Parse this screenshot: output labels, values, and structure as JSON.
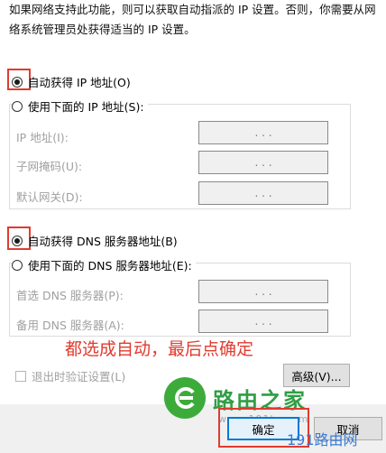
{
  "description_text": "如果网络支持此功能，则可以获取自动指派的 IP 设置。否则，你需要从网络系统管理员处获得适当的 IP 设置。",
  "ip_section": {
    "auto_label": "自动获得 IP 地址(O)",
    "auto_selected": true,
    "manual_label": "使用下面的 IP 地址(S):",
    "fields": [
      {
        "label": "IP 地址(I):",
        "value": ". . ."
      },
      {
        "label": "子网掩码(U):",
        "value": ". . ."
      },
      {
        "label": "默认网关(D):",
        "value": ". . ."
      }
    ]
  },
  "dns_section": {
    "auto_label": "自动获得 DNS 服务器地址(B)",
    "auto_selected": true,
    "manual_label": "使用下面的 DNS 服务器地址(E):",
    "fields": [
      {
        "label": "首选 DNS 服务器(P):",
        "value": ". . ."
      },
      {
        "label": "备用 DNS 服务器(A):",
        "value": ". . ."
      }
    ]
  },
  "annotation": "都选成自动，最后点确定",
  "validate_checkbox_label": "退出时验证设置(L)",
  "advanced_button": "高级(V)...",
  "ok_button": "确定",
  "cancel_button": "取消",
  "watermark": {
    "brand": "路由之家",
    "site": "www.191lu.com",
    "corner": "191路由网"
  },
  "colors": {
    "annotation_red": "#e03b2f",
    "primary_blue": "#0078d7",
    "watermark_green": "#3cab3a"
  }
}
